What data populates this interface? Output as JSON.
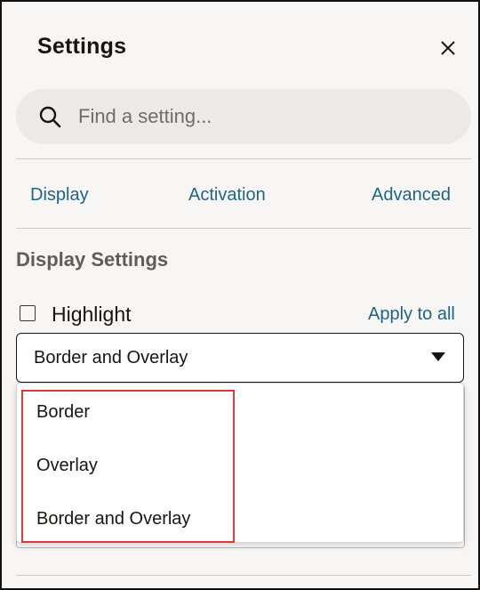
{
  "panel": {
    "title": "Settings",
    "close_icon": "close-icon"
  },
  "search": {
    "placeholder": "Find a setting...",
    "value": "",
    "icon": "search-icon"
  },
  "tabs": [
    {
      "label": "Display"
    },
    {
      "label": "Activation"
    },
    {
      "label": "Advanced"
    }
  ],
  "section": {
    "title": "Display Settings"
  },
  "highlight": {
    "label": "Highlight",
    "checked": false,
    "apply_all_label": "Apply to all",
    "selected_value": "Border and Overlay",
    "options": [
      "Border",
      "Overlay",
      "Border and Overlay"
    ]
  },
  "colors": {
    "accent_link": "#1f6485",
    "panel_bg": "#f7f6f4",
    "annotation_red": "#e0373b"
  }
}
